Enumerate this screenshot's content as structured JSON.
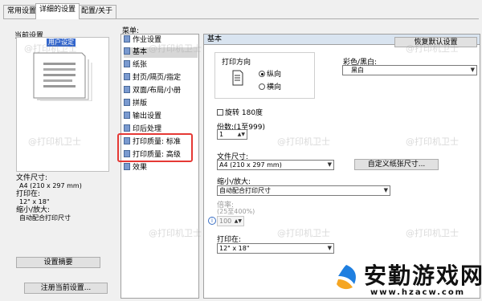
{
  "tabs": [
    "常用设置",
    "详细的设置",
    "配置/关于"
  ],
  "left": {
    "current_label": "当前设置",
    "preview_selected": "用户设定",
    "info": {
      "paper_size_label": "文件尺寸:",
      "paper_size_value": "A4 (210 x 297 mm)",
      "print_on_label": "打印在:",
      "print_on_value": "12\" x 18\"",
      "scale_label": "缩小/放大:",
      "scale_value": "自动配合打印尺寸"
    },
    "settings_summary_button": "设置摘要",
    "register_button": "注册当前设置..."
  },
  "menu": {
    "label": "菜单:",
    "items": [
      "作业设置",
      "基本",
      "纸张",
      "封页/隔页/指定",
      "双面/布局/小册",
      "拼版",
      "输出设置",
      "印后处理",
      "打印质量: 标准",
      "打印质量: 高级",
      "效果"
    ],
    "selected_index": 1
  },
  "basic": {
    "header": "基本",
    "restore_button": "恢复默认设置",
    "orientation_label": "打印方向",
    "portrait": "纵向",
    "landscape": "横向",
    "color_label": "彩色/黑白:",
    "color_value": "黑白",
    "rotate_label": "旋转 180度",
    "copies_label": "份数:(1至999)",
    "copies_value": "1",
    "paper_size_label": "文件尺寸:",
    "paper_size_value": "A4 (210 x 297 mm)",
    "custom_size_button": "自定义纸张尺寸...",
    "scale_label": "缩小/放大:",
    "scale_value": "自动配合打印尺寸",
    "ratio_label": "倍率:",
    "ratio_range": "(25至400%)",
    "ratio_value": "100",
    "print_on_label": "打印在:",
    "print_on_value": "12\" x 18\""
  },
  "watermarks": [
    "@打印机卫士",
    "@打印机卫士",
    "@打印机卫士",
    "@打印机卫士",
    "@打印机卫士",
    "@打印机卫士",
    "@打印机卫士",
    "@打印机卫士",
    "@打印机卫士"
  ],
  "logo": {
    "text": "安勤游戏网",
    "url": "www.hzacw.com"
  }
}
